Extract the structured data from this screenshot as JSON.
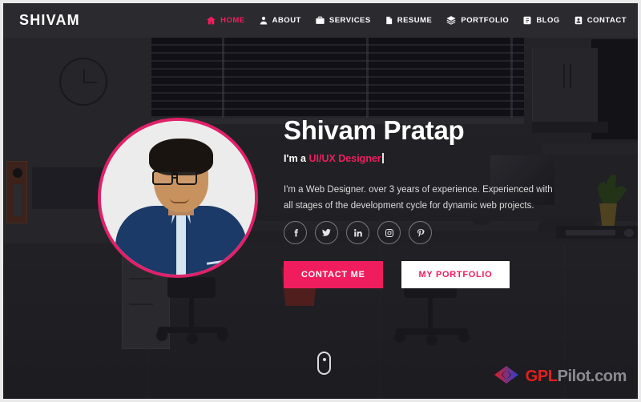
{
  "theme": {
    "accent": "#ef1d5e",
    "accent_ring": "#e0216a",
    "header_bg": "#2b2b2f",
    "text_light": "#ffffff",
    "text_muted": "#dcdcdc",
    "floor": "#26262b",
    "wall": "#2c2c30"
  },
  "header": {
    "logo": "SHIVAM",
    "nav": [
      {
        "label": "HOME",
        "icon": "home-icon",
        "active": true
      },
      {
        "label": "ABOUT",
        "icon": "user-icon",
        "active": false
      },
      {
        "label": "SERVICES",
        "icon": "briefcase-icon",
        "active": false
      },
      {
        "label": "RESUME",
        "icon": "document-icon",
        "active": false
      },
      {
        "label": "PORTFOLIO",
        "icon": "layers-icon",
        "active": false
      },
      {
        "label": "BLOG",
        "icon": "note-icon",
        "active": false
      },
      {
        "label": "CONTACT",
        "icon": "contact-icon",
        "active": false
      }
    ]
  },
  "hero": {
    "avatar_alt": "profile-photo",
    "name": "Shivam Pratap",
    "role_prefix": "I'm a ",
    "role_typed": "UI/UX Designer",
    "description": "I'm a Web Designer. over 3 years of experience. Experienced with all stages of the development cycle for dynamic web projects.",
    "socials": [
      {
        "name": "facebook-icon",
        "label": "f"
      },
      {
        "name": "twitter-icon",
        "label": "t"
      },
      {
        "name": "linkedin-icon",
        "label": "in"
      },
      {
        "name": "instagram-icon",
        "label": "ig"
      },
      {
        "name": "pinterest-icon",
        "label": "p"
      }
    ],
    "buttons": {
      "primary": "CONTACT ME",
      "secondary": "MY PORTFOLIO"
    },
    "scroll_indicator": "scroll-mouse-icon"
  },
  "background": {
    "scene": "office-illustration",
    "elements": [
      "wall-clock",
      "window-blinds",
      "wall-cabinet",
      "potted-plant",
      "desk",
      "monitor",
      "keyboard",
      "mouse",
      "office-chairs",
      "filing-cabinet",
      "red-plant-pot",
      "wall-speaker"
    ]
  },
  "watermark": {
    "brand_primary": "GPL",
    "brand_secondary": "Pilot.com",
    "logo": "gplpilot-diamond-logo"
  }
}
